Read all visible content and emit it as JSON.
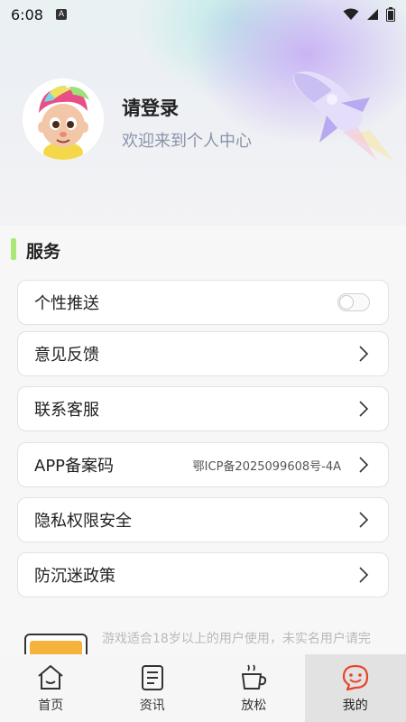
{
  "status_bar": {
    "time": "6:08",
    "notif_icon_letter": "A"
  },
  "profile": {
    "title": "请登录",
    "subtitle": "欢迎来到个人中心"
  },
  "services": {
    "section_title": "服务",
    "items": [
      {
        "label": "个性推送",
        "control": "toggle",
        "toggle_on": false
      },
      {
        "label": "意见反馈",
        "control": "chevron"
      },
      {
        "label": "联系客服",
        "control": "chevron"
      },
      {
        "label": "APP备案码",
        "value": "鄂ICP备2025099608号-4A",
        "control": "chevron"
      },
      {
        "label": "隐私权限安全",
        "control": "chevron"
      },
      {
        "label": "防沉迷政策",
        "control": "chevron"
      }
    ]
  },
  "notice": {
    "text": "游戏适合18岁以上的用户使用，未实名用户请完"
  },
  "tabbar": {
    "tabs": [
      {
        "label": "首页",
        "icon": "home-icon",
        "active": false
      },
      {
        "label": "资讯",
        "icon": "news-icon",
        "active": false
      },
      {
        "label": "放松",
        "icon": "coffee-cup-icon",
        "active": false
      },
      {
        "label": "我的",
        "icon": "smile-chat-icon",
        "active": true
      }
    ]
  },
  "colors": {
    "accent_section_bar": "#a9e878",
    "active_tab_icon": "#e8442d",
    "active_tab_bg": "#e2e2e2"
  }
}
